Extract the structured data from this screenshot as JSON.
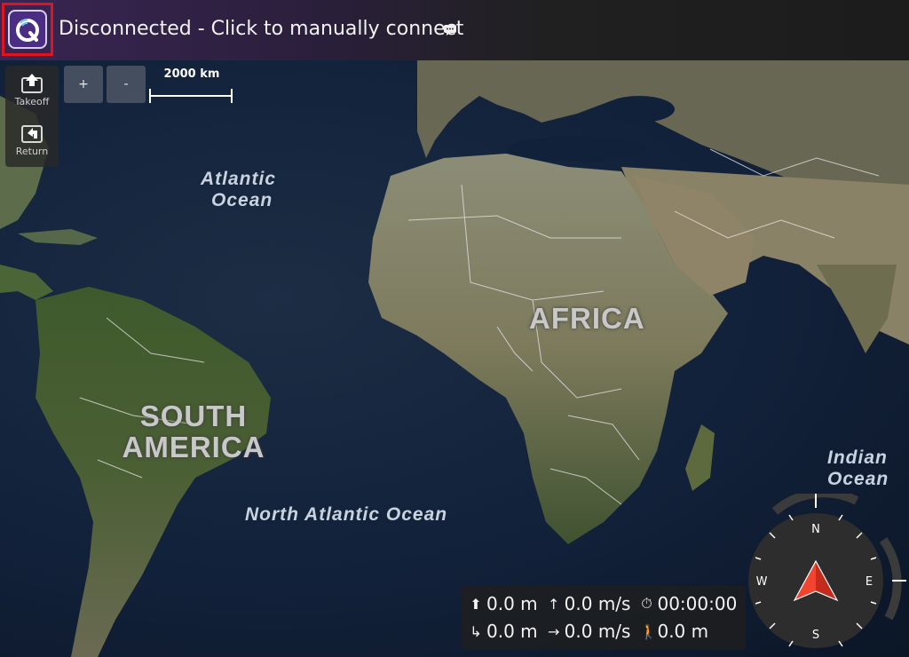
{
  "header": {
    "status_text": "Disconnected - Click to manually connect",
    "status_icon": "message-icon",
    "logo_icon": "qgc-logo-icon",
    "accent_color": "#e0141c"
  },
  "toolbar": {
    "takeoff_label": "Takeoff",
    "return_label": "Return"
  },
  "zoom": {
    "in_label": "+",
    "out_label": "-"
  },
  "scale": {
    "label": "2000 km"
  },
  "map_labels": {
    "atlantic_line1": "Atlantic",
    "atlantic_line2": "Ocean",
    "indian_line1": "Indian",
    "indian_line2": "Ocean",
    "north_atlantic": "North Atlantic Ocean",
    "africa": "AFRICA",
    "south_america_line1": "SOUTH",
    "south_america_line2": "AMERICA"
  },
  "telemetry": {
    "altitude": "0.0 m",
    "vertical_speed": "0.0 m/s",
    "flight_time": "00:00:00",
    "distance_to_home": "0.0 m",
    "horizontal_speed": "0.0 m/s",
    "distance_to_gcs": "0.0 m"
  },
  "compass": {
    "north": "N",
    "south": "S",
    "east": "E",
    "west": "W",
    "heading_color": "#e03a2a"
  }
}
